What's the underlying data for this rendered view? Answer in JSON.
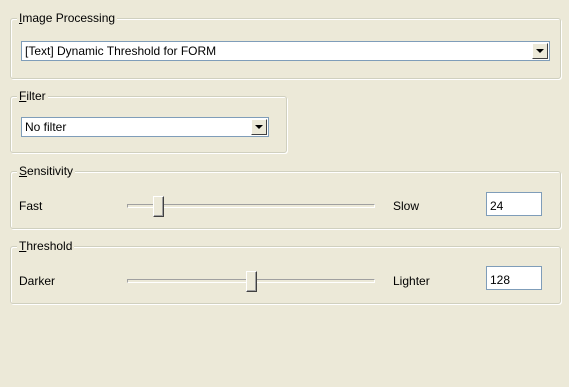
{
  "image_processing": {
    "legend_mnemonic": "I",
    "legend_rest": "mage Processing",
    "selected": "[Text] Dynamic Threshold for FORM"
  },
  "filter": {
    "legend_mnemonic": "F",
    "legend_rest": "ilter",
    "selected": "No filter"
  },
  "sensitivity": {
    "legend_mnemonic": "S",
    "legend_rest": "ensitivity",
    "min_label": "Fast",
    "max_label": "Slow",
    "value": "24",
    "slider_fraction": 0.11
  },
  "threshold": {
    "legend_mnemonic": "T",
    "legend_rest": "hreshold",
    "min_label": "Darker",
    "max_label": "Lighter",
    "value": "128",
    "slider_fraction": 0.5
  },
  "icons": {
    "dropdown": "chevron-down-icon"
  }
}
